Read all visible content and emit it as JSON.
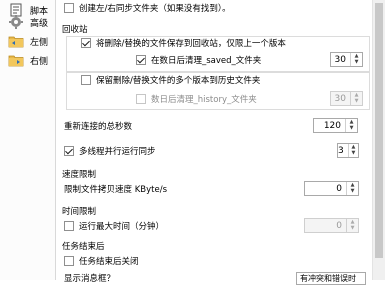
{
  "sidebar": {
    "items": [
      {
        "label": "脚本",
        "icon": "script-icon"
      },
      {
        "label": "高级",
        "icon": "gear-icon"
      },
      {
        "label": "左侧",
        "icon": "folder-left-icon"
      },
      {
        "label": "右侧",
        "icon": "folder-right-icon"
      }
    ]
  },
  "options": {
    "create_folders_label": "创建左/右同步文件夹（如果没有找到）。",
    "recycle_section": "回收站",
    "save_to_recycle_label": "将删除/替换的文件保存到回收站，仅限上一个版本",
    "clean_saved_label": "在数日后清理_saved_文件夹",
    "clean_saved_value": "30",
    "keep_versions_label": "保留删除/替换文件的多个版本到历史文件夹",
    "clean_history_label": "数日后清理_history_文件夹",
    "clean_history_value": "30",
    "reconnect_label": "重新连接的总秒数",
    "reconnect_value": "120",
    "multithread_label": "多线程并行运行同步",
    "multithread_value": "3",
    "speed_section": "速度限制",
    "speed_label": "限制文件拷贝速度 KByte/s",
    "speed_value": "0",
    "time_section": "时间限制",
    "time_label": "运行最大时间（分钟）",
    "time_value": "0",
    "after_section": "任务结束后",
    "after_label": "任务结束后关闭",
    "show_msg_label": "显示消息框？",
    "show_msg_value": "有冲突和错误时"
  }
}
